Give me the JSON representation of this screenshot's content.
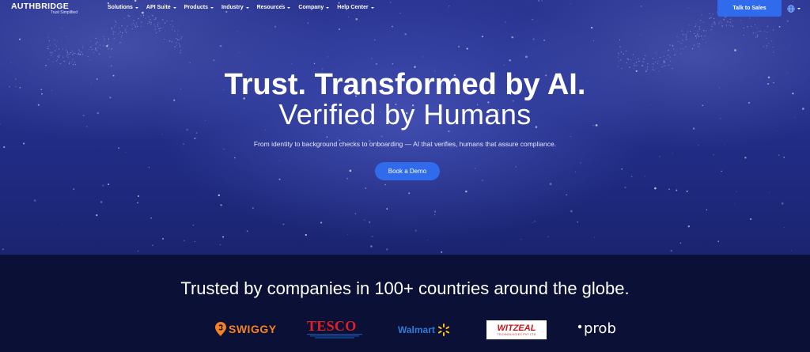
{
  "nav": {
    "logo": {
      "word": "AUTHBRIDGE",
      "tagline": "Trust Simplified"
    },
    "menu": [
      "Solutions",
      "API Suite",
      "Products",
      "Industry",
      "Resources",
      "Company",
      "Help Center"
    ],
    "cta": "Talk to Sales",
    "language_icon": "globe-icon"
  },
  "hero": {
    "headline": "Trust. Transformed by AI.",
    "subheadline": "Verified by Humans",
    "tagline": "From identity to background checks to onboarding — AI that verifies, humans that assure compliance.",
    "cta": "Book a Demo"
  },
  "trust": {
    "title": "Trusted by companies in 100+ countries around the globe.",
    "logos": {
      "swiggy": "SWIGGY",
      "tesco": "TESCO",
      "walmart": "Walmart",
      "witzeal": "WITZEAL",
      "witzeal_sub": "TECHNOLOGIES PVT LTD",
      "prob": "prob"
    }
  },
  "colors": {
    "accent": "#2f6bea",
    "hero_bg": "#24308c",
    "band_bg": "#0b1036",
    "swiggy": "#f5821f",
    "tesco": "#e31e25",
    "walmart": "#2f7bd6",
    "walmart_spark": "#ffc220"
  }
}
